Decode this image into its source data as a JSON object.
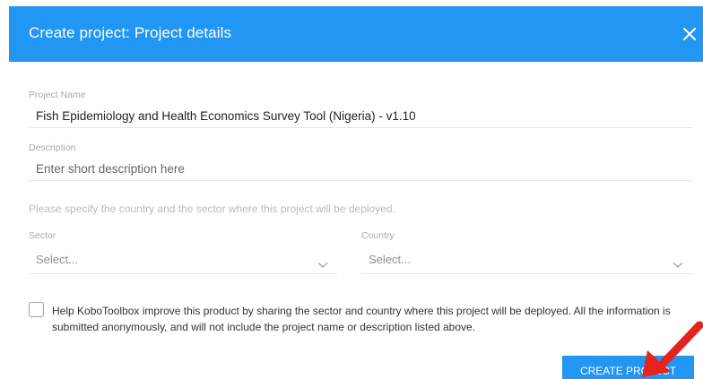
{
  "dialog": {
    "title": "Create project: Project details",
    "close_icon": "close-icon"
  },
  "form": {
    "project_name_label": "Project Name",
    "project_name_value": "Fish Epidemiology and Health Economics Survey Tool (Nigeria) - v1.10",
    "description_label": "Description",
    "description_placeholder": "Enter short description here",
    "deployment_hint": "Please specify the country and the sector where this project will be deployed.",
    "sector": {
      "label": "Sector",
      "value": "Select..."
    },
    "country": {
      "label": "Country",
      "value": "Select..."
    },
    "consent_text": "Help KoboToolbox improve this product by sharing the sector and country where this project will be deployed. All the information is submitted anonymously, and will not include the project name or description listed above.",
    "consent_checked": false
  },
  "actions": {
    "create_label": "CREATE PROJECT"
  },
  "colors": {
    "accent": "#2196f3",
    "annotation_arrow": "#e8231d"
  }
}
